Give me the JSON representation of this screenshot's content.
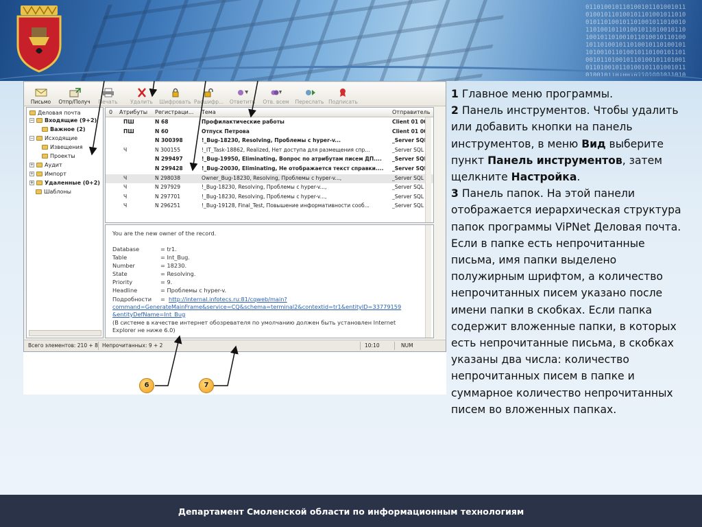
{
  "colors": {
    "banner_blue": "#3d77b8",
    "footer_bg": "#2a3348",
    "badge": "#f0a020",
    "selected_row": "#e6e6e6",
    "link": "#2a5fb0"
  },
  "app": {
    "toolbar": [
      {
        "label": "Письмо",
        "icon": "letter-icon",
        "enabled": true
      },
      {
        "label": "Отпр/Получ",
        "icon": "send-receive-icon",
        "enabled": true
      },
      {
        "label": "Печать",
        "icon": "printer-icon",
        "enabled": false
      },
      {
        "label": "Удалить",
        "icon": "delete-x-icon",
        "enabled": false
      },
      {
        "label": "Шифровать",
        "icon": "lock-icon",
        "enabled": false
      },
      {
        "label": "Расшифр...",
        "icon": "unlock-icon",
        "enabled": false
      },
      {
        "label": "Ответить",
        "icon": "reply-icon",
        "enabled": false
      },
      {
        "label": "Отв. всем",
        "icon": "reply-all-icon",
        "enabled": false
      },
      {
        "label": "Переслать",
        "icon": "forward-icon",
        "enabled": false
      },
      {
        "label": "Подписать",
        "icon": "sign-ribbon-icon",
        "enabled": false
      }
    ],
    "folders": [
      {
        "label": "Деловая почта",
        "bold": false
      },
      {
        "label": "Входящие (9+2)",
        "bold": true
      },
      {
        "label": "Важное (2)",
        "bold": true
      },
      {
        "label": "Исходящие",
        "bold": false
      },
      {
        "label": "Извещения",
        "bold": false
      },
      {
        "label": "Проекты",
        "bold": false
      },
      {
        "label": "Аудит",
        "bold": false
      },
      {
        "label": "Импорт",
        "bold": false
      },
      {
        "label": "Удаленные (0+2)",
        "bold": true
      },
      {
        "label": "Шаблоны",
        "bold": false
      }
    ],
    "columns": {
      "attach": "0",
      "attrs": "Атрибуты",
      "reg": "Регистраци...",
      "subject": "Тема",
      "sender": "Отправитель"
    },
    "messages": [
      {
        "attrs": "ПШ",
        "reg": "N 68",
        "subject": "Профилактические работы",
        "sender": "Client 01 001",
        "bold": true,
        "selected": false
      },
      {
        "attrs": "ПШ",
        "reg": "N 60",
        "subject": "Отпуск Петрова",
        "sender": "Client 01 001",
        "bold": true,
        "selected": false
      },
      {
        "attrs": "",
        "reg": "N 300398",
        "subject": "!_Bug-18230, Resolving, Проблемы с hyper-v...",
        "sender": "_Server SQL 01 1",
        "bold": true,
        "selected": false
      },
      {
        "attrs": "Ч",
        "reg": "N 300155",
        "subject": "!_IT_Task-18862, Realized, Нет доступа для размещения спр...",
        "sender": "_Server SQL 01 1",
        "bold": false,
        "selected": false
      },
      {
        "attrs": "",
        "reg": "N 299497",
        "subject": "!_Bug-19950, Eliminating, Вопрос по атрибутам писем ДП....",
        "sender": "_Server SQL 01 1",
        "bold": true,
        "selected": false
      },
      {
        "attrs": "",
        "reg": "N 299428",
        "subject": "!_Bug-20030, Eliminating, Не отображается текст справки....",
        "sender": "_Server SQL 01 1",
        "bold": true,
        "selected": false
      },
      {
        "attrs": "Ч",
        "reg": "N 298038",
        "subject": "Owner_Bug-18230, Resolving, Проблемы с hyper-v...,",
        "sender": "_Server SQL 01 1",
        "bold": false,
        "selected": true
      },
      {
        "attrs": "Ч",
        "reg": "N 297929",
        "subject": "!_Bug-18230, Resolving, Проблемы с hyper-v...,",
        "sender": "_Server SQL 01 1",
        "bold": false,
        "selected": false
      },
      {
        "attrs": "Ч",
        "reg": "N 297701",
        "subject": "!_Bug-18230, Resolving, Проблемы с hyper-v...,",
        "sender": "_Server SQL 01 1",
        "bold": false,
        "selected": false
      },
      {
        "attrs": "Ч",
        "reg": "N 296251",
        "subject": "!_Bug-19128, Final_Test, Повышение информативности сооб...",
        "sender": "_Server SQL 01 1",
        "bold": false,
        "selected": false
      }
    ],
    "preview": {
      "intro": "You are the new owner of the record.",
      "fields": [
        {
          "k": "Database",
          "v": "=  tr1."
        },
        {
          "k": "Table",
          "v": "=  Int_Bug."
        },
        {
          "k": "Number",
          "v": "=  18230."
        },
        {
          "k": "State",
          "v": "=  Resolving."
        },
        {
          "k": "Priority",
          "v": "=  9."
        },
        {
          "k": "Headline",
          "v": "=  Проблемы с hyper-v."
        }
      ],
      "details_key": "Подробности",
      "details_eq": "=",
      "link1": "http://internal.infotecs.ru:81/cqweb/main?",
      "link2": "command=GenerateMainFrame&service=CQ&schema=terminal2&contextid=tr1&entityID=33779159",
      "link3": "&entityDefName=Int_Bug",
      "note1": "(В системе в качестве интернет обозревателя по умолчанию должен быть установлен Internet",
      "note2": "Explorer не ниже 6.0)"
    },
    "status": {
      "total": "Всего элементов: 210 + 8",
      "unread": "Непрочитанных: 9 + 2",
      "time": "10:10",
      "num": "NUM"
    }
  },
  "callouts": [
    "6",
    "7"
  ],
  "text": [
    {
      "num": "1",
      "parts": [
        {
          "t": " Главное меню программы.",
          "b": false
        }
      ]
    },
    {
      "num": "2",
      "parts": [
        {
          "t": " Панель инструментов. Чтобы удалить или добавить кнопки на панель инструментов, в меню ",
          "b": false
        },
        {
          "t": "Вид",
          "b": true
        },
        {
          "t": " выберите пункт ",
          "b": false
        },
        {
          "t": "Панель инструментов",
          "b": true
        },
        {
          "t": ", затем щелкните ",
          "b": false
        },
        {
          "t": "Настройка",
          "b": true
        },
        {
          "t": ".",
          "b": false
        }
      ]
    },
    {
      "num": "3",
      "parts": [
        {
          "t": " Панель папок. На этой панели отображается иерархическая структура папок программы ViPNet Деловая почта.",
          "b": false
        }
      ]
    },
    {
      "num": "",
      "parts": [
        {
          "t": "Если в папке есть непрочитанные письма, имя папки выделено полужирным шрифтом, а количество непрочитанных писем указано после имени папки в скобках. Если папка содержит вложенные папки, в которых есть непрочитанные письма, в скобках указаны два числа: количество непрочитанных писем в папке и суммарное количество непрочитанных писем во вложенных папках.",
          "b": false
        }
      ]
    }
  ],
  "footer": "Департамент Смоленской области по информационным технологиям"
}
